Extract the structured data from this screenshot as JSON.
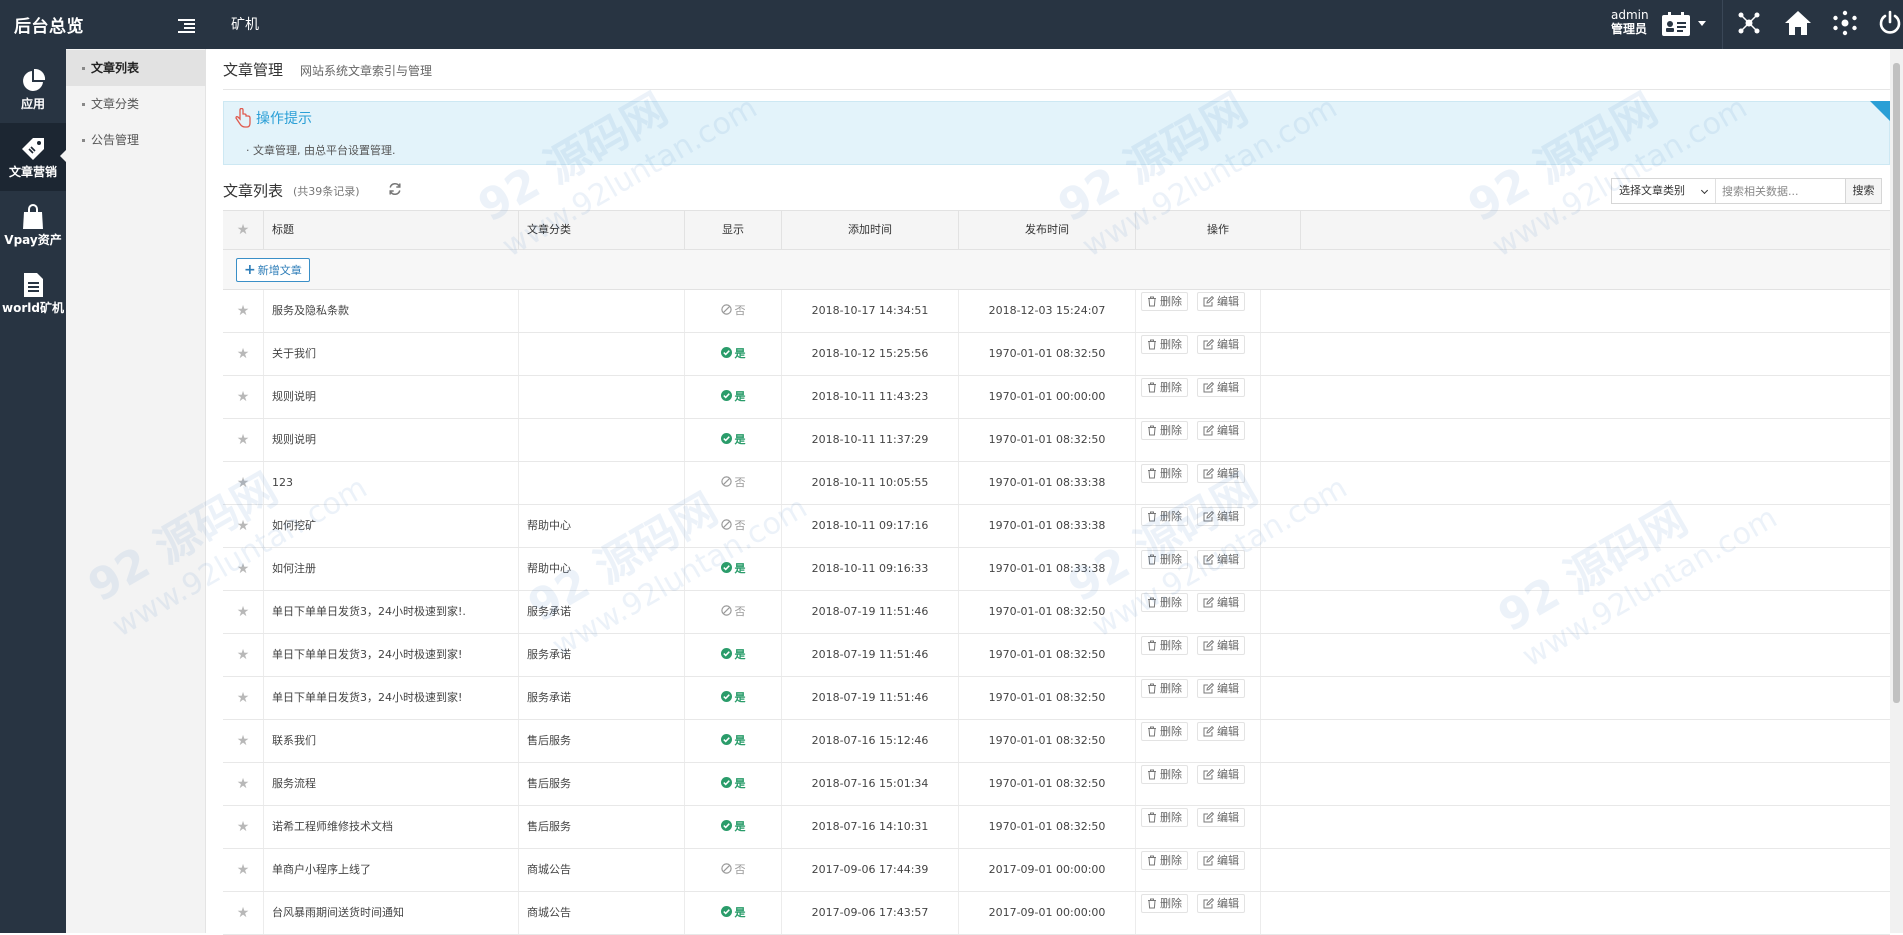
{
  "header": {
    "brand": "后台总览",
    "breadcrumb": "矿机",
    "user_name": "admin",
    "user_role": "管理员"
  },
  "left_nav": [
    {
      "label": "应用",
      "icon": "pie-chart-icon"
    },
    {
      "label": "文章营销",
      "icon": "tag-icon",
      "active": true
    },
    {
      "label": "Vpay资产",
      "icon": "bag-icon"
    },
    {
      "label": "world矿机",
      "icon": "document-icon"
    }
  ],
  "sub_nav": [
    {
      "label": "文章列表",
      "active": true
    },
    {
      "label": "文章分类"
    },
    {
      "label": "公告管理"
    }
  ],
  "page": {
    "title": "文章管理",
    "subtitle": "网站系统文章索引与管理"
  },
  "tips": {
    "title": "操作提示",
    "line": "文章管理, 由总平台设置管理."
  },
  "list": {
    "title": "文章列表",
    "count": "(共39条记录)",
    "category_select": "选择文章类别",
    "search_placeholder": "搜索相关数据...",
    "search_button": "搜索",
    "add_button": "新增文章"
  },
  "columns": {
    "title": "标题",
    "category": "文章分类",
    "show": "显示",
    "add_time": "添加时间",
    "publish_time": "发布时间",
    "ops": "操作"
  },
  "actions": {
    "delete": "删除",
    "edit": "编辑"
  },
  "rows": [
    {
      "title": "服务及隐私条款",
      "category": "",
      "show": "否",
      "add": "2018-10-17 14:34:51",
      "pub": "2018-12-03 15:24:07"
    },
    {
      "title": "关于我们",
      "category": "",
      "show": "是",
      "add": "2018-10-12 15:25:56",
      "pub": "1970-01-01 08:32:50"
    },
    {
      "title": "规则说明",
      "category": "",
      "show": "是",
      "add": "2018-10-11 11:43:23",
      "pub": "1970-01-01 00:00:00"
    },
    {
      "title": "规则说明",
      "category": "",
      "show": "是",
      "add": "2018-10-11 11:37:29",
      "pub": "1970-01-01 08:32:50"
    },
    {
      "title": "123",
      "category": "",
      "show": "否",
      "add": "2018-10-11 10:05:55",
      "pub": "1970-01-01 08:33:38"
    },
    {
      "title": "如何挖矿",
      "category": "帮助中心",
      "show": "否",
      "add": "2018-10-11 09:17:16",
      "pub": "1970-01-01 08:33:38"
    },
    {
      "title": "如何注册",
      "category": "帮助中心",
      "show": "是",
      "add": "2018-10-11 09:16:33",
      "pub": "1970-01-01 08:33:38"
    },
    {
      "title": "单日下单单日发货3，24小时极速到家!.",
      "category": "服务承诺",
      "show": "否",
      "add": "2018-07-19 11:51:46",
      "pub": "1970-01-01 08:32:50"
    },
    {
      "title": "单日下单单日发货3，24小时极速到家!",
      "category": "服务承诺",
      "show": "是",
      "add": "2018-07-19 11:51:46",
      "pub": "1970-01-01 08:32:50"
    },
    {
      "title": "单日下单单日发货3，24小时极速到家!",
      "category": "服务承诺",
      "show": "是",
      "add": "2018-07-19 11:51:46",
      "pub": "1970-01-01 08:32:50"
    },
    {
      "title": "联系我们",
      "category": "售后服务",
      "show": "是",
      "add": "2018-07-16 15:12:46",
      "pub": "1970-01-01 08:32:50"
    },
    {
      "title": "服务流程",
      "category": "售后服务",
      "show": "是",
      "add": "2018-07-16 15:01:34",
      "pub": "1970-01-01 08:32:50"
    },
    {
      "title": "诺希工程师维修技术文档",
      "category": "售后服务",
      "show": "是",
      "add": "2018-07-16 14:10:31",
      "pub": "1970-01-01 08:32:50"
    },
    {
      "title": "单商户小程序上线了",
      "category": "商城公告",
      "show": "否",
      "add": "2017-09-06 17:44:39",
      "pub": "2017-09-01 00:00:00"
    },
    {
      "title": "台风暴雨期间送货时间通知",
      "category": "商城公告",
      "show": "是",
      "add": "2017-09-06 17:43:57",
      "pub": "2017-09-01 00:00:00"
    }
  ],
  "colors": {
    "header_bg": "#283442",
    "accent": "#2a9fd6",
    "yes": "#2a9c6a"
  }
}
